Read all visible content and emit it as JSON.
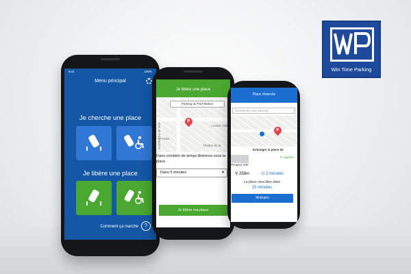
{
  "logo": {
    "text": "Win Time Parking"
  },
  "phone1": {
    "status_time": "9:41",
    "status_batt": "100%",
    "header_title": "Menu principal",
    "search_section": "Je cherche une place",
    "free_section": "Je libère une place",
    "help_link": "Comment ça marche",
    "help_icon_glyph": "?"
  },
  "phone2": {
    "header_title": "Je libère une place",
    "location_chip": "Parking du Port-Mahon",
    "map_labels": [
      "Rue du Port-Mahon",
      "L'Usine Opé",
      "Théâtre de la",
      "AA Paris"
    ],
    "question": "Dans combien de temps libérerez-vous la place.",
    "select_value": "Dans 5 minutes",
    "submit_button": "Je libère ma place"
  },
  "phone3": {
    "header_title": "Place réservée",
    "search_placeholder": "Rechercher une adresse",
    "exchange_title": "Echanger la place de",
    "appeler": "Appeler",
    "car_label": "Peugeot 206",
    "distance": "258m",
    "duration": "2 minutes",
    "free_text": "La place sera libre dans",
    "free_minutes": "15 minutes",
    "itinerary_button": "Itinéraire"
  },
  "colors": {
    "brand_blue": "#1457a7",
    "tile_blue": "#3178d6",
    "brand_green": "#4aa72f",
    "pin_red": "#e0454d"
  }
}
